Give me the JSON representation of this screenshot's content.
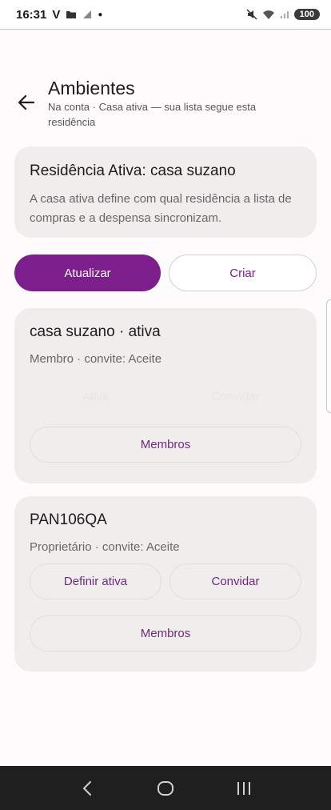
{
  "status_bar": {
    "time": "16:31",
    "carrier_glyph": "V",
    "battery": "100"
  },
  "header": {
    "title": "Ambientes",
    "subtitle": "Na conta · Casa ativa — sua lista segue esta residência"
  },
  "active_info": {
    "title": "Residência Ativa: casa suzano",
    "description": "A casa ativa define com qual residência a lista de compras e a despensa sincronizam."
  },
  "actions": {
    "refresh_label": "Atualizar",
    "create_label": "Criar"
  },
  "environments": [
    {
      "name": "casa suzano · ativa",
      "meta": "Membro · convite: Aceite",
      "ghost_left": "Ativa",
      "ghost_right": "Convidar",
      "members_label": "Membros"
    },
    {
      "name": "PAN106QA",
      "meta": "Proprietário · convite: Aceite",
      "set_active_label": "Definir ativa",
      "invite_label": "Convidar",
      "members_label": "Membros"
    }
  ],
  "colors": {
    "accent": "#7d1e8d",
    "card_bg": "#f0eeed",
    "background": "#fdfbfb"
  },
  "icons": [
    "back-arrow-icon",
    "nav-back-icon",
    "nav-home-icon",
    "nav-recents-icon"
  ]
}
